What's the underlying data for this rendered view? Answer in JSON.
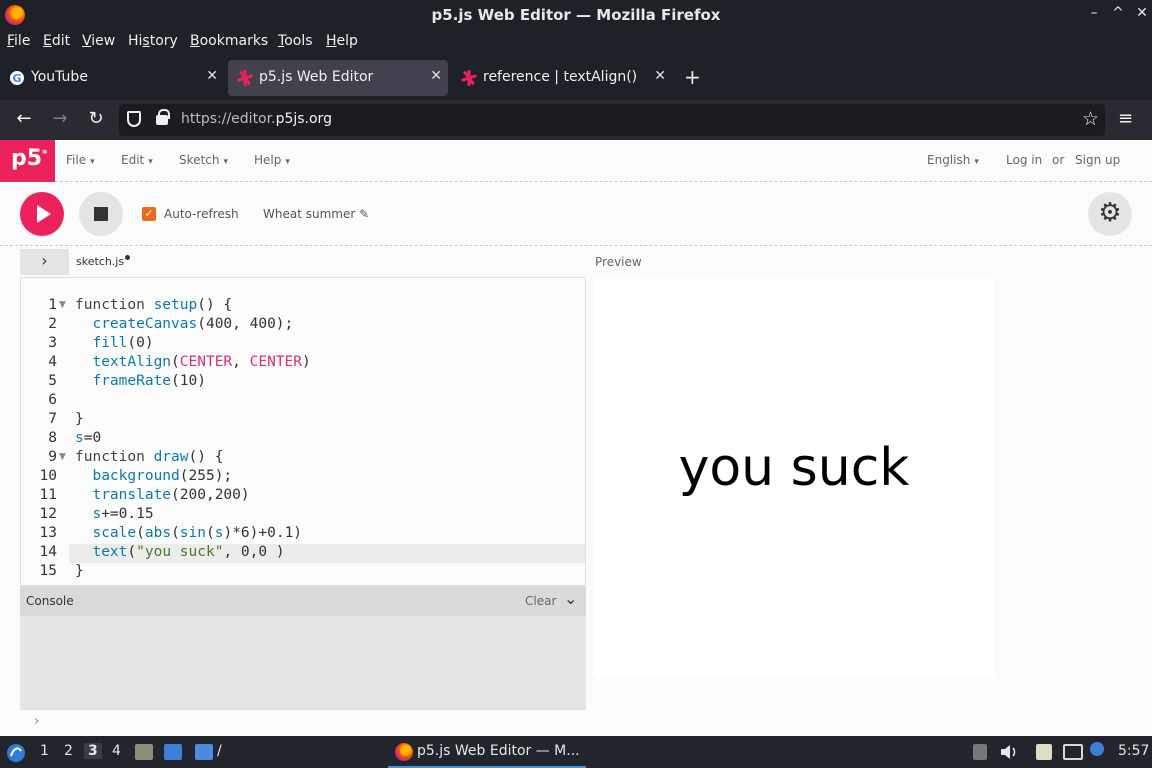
{
  "window": {
    "title": "p5.js Web Editor — Mozilla Firefox",
    "controls": [
      "–",
      "^",
      "✕"
    ]
  },
  "menubar": {
    "items": [
      {
        "label": "File",
        "accel": "F",
        "rest": "ile"
      },
      {
        "label": "Edit",
        "accel": "E",
        "rest": "dit"
      },
      {
        "label": "View",
        "accel": "V",
        "rest": "iew"
      },
      {
        "label": "History",
        "accel": "s",
        "pre": "Hi",
        "rest": "tory"
      },
      {
        "label": "Bookmarks",
        "accel": "B",
        "rest": "ookmarks"
      },
      {
        "label": "Tools",
        "accel": "T",
        "rest": "ools"
      },
      {
        "label": "Help",
        "accel": "H",
        "rest": "elp"
      }
    ]
  },
  "tabs": [
    {
      "label": "YouTube",
      "icon": "google-g-icon",
      "active": false,
      "close": "✕"
    },
    {
      "label": "p5.js Web Editor",
      "icon": "p5-asterisk-icon",
      "active": true,
      "close": "✕"
    },
    {
      "label": "reference | textAlign()",
      "icon": "p5-asterisk-icon",
      "active": false,
      "close": "✕"
    }
  ],
  "newtab": "+",
  "nav": {
    "back": "←",
    "forward": "→",
    "reload": "↻",
    "url_prefix": "https://editor.",
    "url_domain": "p5js.org",
    "star": "☆",
    "menu": "≡"
  },
  "p5header": {
    "logo": "p5",
    "logo_sup": "*",
    "menus": [
      "File",
      "Edit",
      "Sketch",
      "Help"
    ],
    "language": "English",
    "login": "Log in",
    "or": "or",
    "signup": "Sign up",
    "caret": "▾"
  },
  "toolbar": {
    "autorefresh_label": "Auto-refresh",
    "autorefresh_checked": "✓",
    "sketch_name": "Wheat summer",
    "pencil": "✎",
    "gear": "⚙"
  },
  "editor": {
    "sidebar_toggle": "›",
    "file_tab": "sketch.js",
    "preview_label": "Preview",
    "active_line": 14,
    "lines": [
      {
        "n": "1",
        "fold": true
      },
      {
        "n": "2",
        "fold": false
      },
      {
        "n": "3",
        "fold": false
      },
      {
        "n": "4",
        "fold": false
      },
      {
        "n": "5",
        "fold": false
      },
      {
        "n": "6",
        "fold": false
      },
      {
        "n": "7",
        "fold": false
      },
      {
        "n": "8",
        "fold": false
      },
      {
        "n": "9",
        "fold": true
      },
      {
        "n": "10",
        "fold": false
      },
      {
        "n": "11",
        "fold": false
      },
      {
        "n": "12",
        "fold": false
      },
      {
        "n": "13",
        "fold": false
      },
      {
        "n": "14",
        "fold": false
      },
      {
        "n": "15",
        "fold": false
      }
    ],
    "code": [
      [
        {
          "t": "kw",
          "v": "function "
        },
        {
          "t": "fn",
          "v": "setup"
        },
        {
          "t": "op",
          "v": "() {"
        }
      ],
      [
        {
          "t": "op",
          "v": "  "
        },
        {
          "t": "fn",
          "v": "createCanvas"
        },
        {
          "t": "op",
          "v": "(400, 400);"
        }
      ],
      [
        {
          "t": "op",
          "v": "  "
        },
        {
          "t": "fn",
          "v": "fill"
        },
        {
          "t": "op",
          "v": "(0)"
        }
      ],
      [
        {
          "t": "op",
          "v": "  "
        },
        {
          "t": "fn",
          "v": "textAlign"
        },
        {
          "t": "op",
          "v": "("
        },
        {
          "t": "cn",
          "v": "CENTER"
        },
        {
          "t": "op",
          "v": ", "
        },
        {
          "t": "cn",
          "v": "CENTER"
        },
        {
          "t": "op",
          "v": ")"
        }
      ],
      [
        {
          "t": "op",
          "v": "  "
        },
        {
          "t": "fn",
          "v": "frameRate"
        },
        {
          "t": "op",
          "v": "(10)"
        }
      ],
      [
        {
          "t": "op",
          "v": ""
        }
      ],
      [
        {
          "t": "op",
          "v": "}"
        }
      ],
      [
        {
          "t": "fn",
          "v": "s"
        },
        {
          "t": "op",
          "v": "=0"
        }
      ],
      [
        {
          "t": "kw",
          "v": "function "
        },
        {
          "t": "fn",
          "v": "draw"
        },
        {
          "t": "op",
          "v": "() {"
        }
      ],
      [
        {
          "t": "op",
          "v": "  "
        },
        {
          "t": "fn",
          "v": "background"
        },
        {
          "t": "op",
          "v": "(255);"
        }
      ],
      [
        {
          "t": "op",
          "v": "  "
        },
        {
          "t": "fn",
          "v": "translate"
        },
        {
          "t": "op",
          "v": "(200,200)"
        }
      ],
      [
        {
          "t": "op",
          "v": "  "
        },
        {
          "t": "fn",
          "v": "s"
        },
        {
          "t": "op",
          "v": "+=0.15"
        }
      ],
      [
        {
          "t": "op",
          "v": "  "
        },
        {
          "t": "fn",
          "v": "scale"
        },
        {
          "t": "op",
          "v": "("
        },
        {
          "t": "fn",
          "v": "abs"
        },
        {
          "t": "op",
          "v": "("
        },
        {
          "t": "fn",
          "v": "sin"
        },
        {
          "t": "op",
          "v": "("
        },
        {
          "t": "fn",
          "v": "s"
        },
        {
          "t": "op",
          "v": ")*6)+0.1)"
        }
      ],
      [
        {
          "t": "op",
          "v": "  "
        },
        {
          "t": "fn",
          "v": "text"
        },
        {
          "t": "op",
          "v": "("
        },
        {
          "t": "st",
          "v": "\"you suck\""
        },
        {
          "t": "op",
          "v": ", 0,0 )"
        }
      ],
      [
        {
          "t": "op",
          "v": "}"
        }
      ]
    ]
  },
  "console": {
    "label": "Console",
    "clear": "Clear",
    "chevron": "⌄",
    "prompt": "›"
  },
  "preview": {
    "text": "you suck"
  },
  "taskbar": {
    "workspaces": [
      "1",
      "2",
      "3",
      "4"
    ],
    "active_workspace": "3",
    "slash": "/",
    "window_title": "p5.js Web Editor — M...",
    "clock": "5:57"
  },
  "colors": {
    "p5_pink": "#ed225d",
    "firefox_dark": "#1f2129",
    "checkbox_orange": "#ed6a1c"
  }
}
